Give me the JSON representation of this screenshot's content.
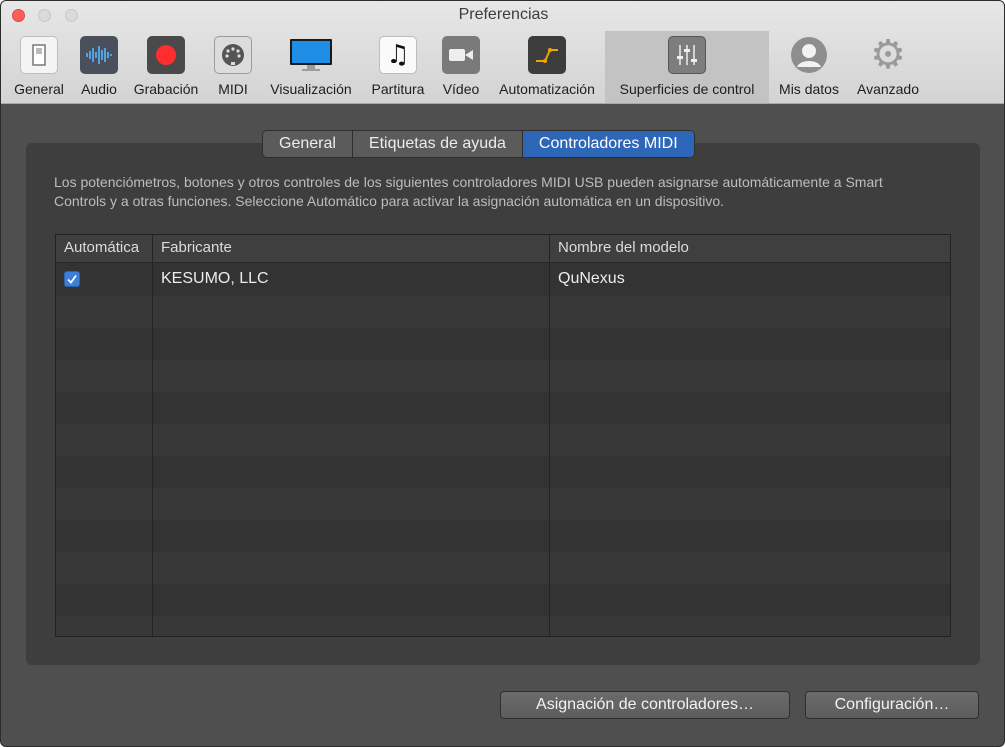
{
  "window": {
    "title": "Preferencias"
  },
  "toolbar": {
    "items": [
      {
        "label": "General",
        "icon": "general-icon"
      },
      {
        "label": "Audio",
        "icon": "audio-waveform-icon"
      },
      {
        "label": "Grabación",
        "icon": "record-icon"
      },
      {
        "label": "MIDI",
        "icon": "midi-connector-icon"
      },
      {
        "label": "Visualización",
        "icon": "display-icon"
      },
      {
        "label": "Partitura",
        "icon": "music-note-icon"
      },
      {
        "label": "Vídeo",
        "icon": "video-camera-icon"
      },
      {
        "label": "Automatización",
        "icon": "automation-icon"
      },
      {
        "label": "Superficies de control",
        "icon": "faders-icon",
        "selected": true
      },
      {
        "label": "Mis datos",
        "icon": "user-icon"
      },
      {
        "label": "Avanzado",
        "icon": "gear-icon"
      }
    ]
  },
  "tabs": [
    {
      "label": "General"
    },
    {
      "label": "Etiquetas de ayuda"
    },
    {
      "label": "Controladores MIDI",
      "active": true
    }
  ],
  "description": "Los potenciómetros, botones y otros controles de los siguientes controladores MIDI USB pueden asignarse automáticamente a Smart Controls y a otras funciones. Seleccione Automático para activar la asignación automática en un dispositivo.",
  "table": {
    "headers": [
      "Automática",
      "Fabricante",
      "Nombre del modelo"
    ],
    "rows": [
      {
        "automatic": true,
        "manufacturer": "KESUMO, LLC",
        "model": "QuNexus"
      }
    ]
  },
  "buttons": {
    "assignment": "Asignación de controladores…",
    "configuration": "Configuración…"
  },
  "colors": {
    "accent": "#2e66b8",
    "close": "#fc5f57",
    "record": "#e8302b",
    "automation": "#f0a500"
  }
}
